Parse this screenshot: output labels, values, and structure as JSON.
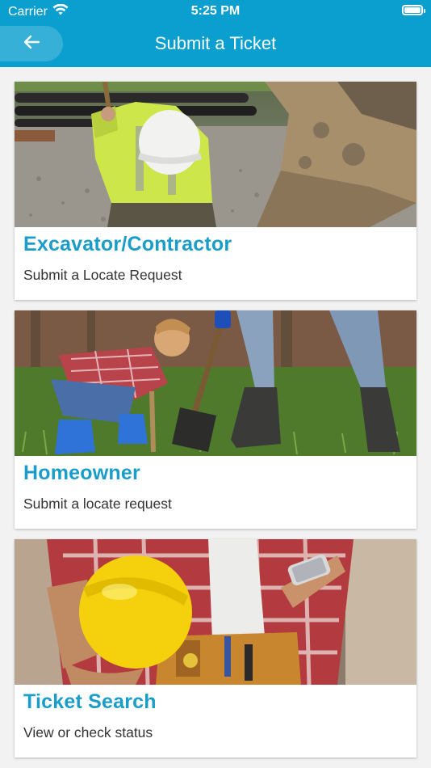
{
  "status_bar": {
    "carrier": "Carrier",
    "time": "5:25 PM"
  },
  "header": {
    "title": "Submit a Ticket",
    "back_icon": "arrow-left-icon",
    "background_color": "#0b9fd0"
  },
  "cards": [
    {
      "title": "Excavator/Contractor",
      "subtitle": "Submit a Locate Request",
      "image": "construction-worker-digging-photo"
    },
    {
      "title": "Homeowner",
      "subtitle": "Submit a locate request",
      "image": "child-digging-with-shovel-photo"
    },
    {
      "title": "Ticket Search",
      "subtitle": "View or check status",
      "image": "worker-with-hardhat-and-phone-photo"
    }
  ],
  "accent_color": "#1a9dc8"
}
